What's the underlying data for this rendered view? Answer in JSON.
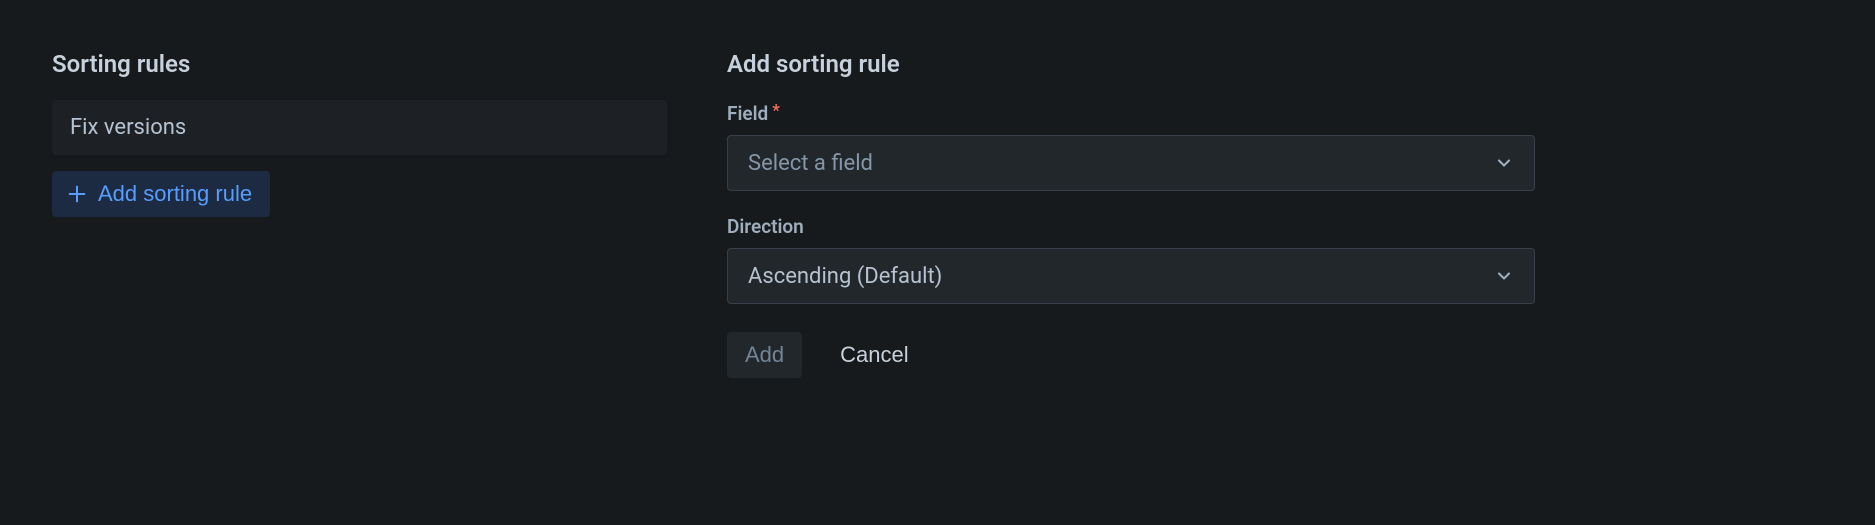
{
  "left": {
    "heading": "Sorting rules",
    "rules": [
      {
        "label": "Fix versions"
      }
    ],
    "add_button_label": "Add sorting rule"
  },
  "right": {
    "heading": "Add sorting rule",
    "field_label": "Field",
    "field_placeholder": "Select a field",
    "direction_label": "Direction",
    "direction_value": "Ascending (Default)",
    "add_label": "Add",
    "cancel_label": "Cancel"
  }
}
